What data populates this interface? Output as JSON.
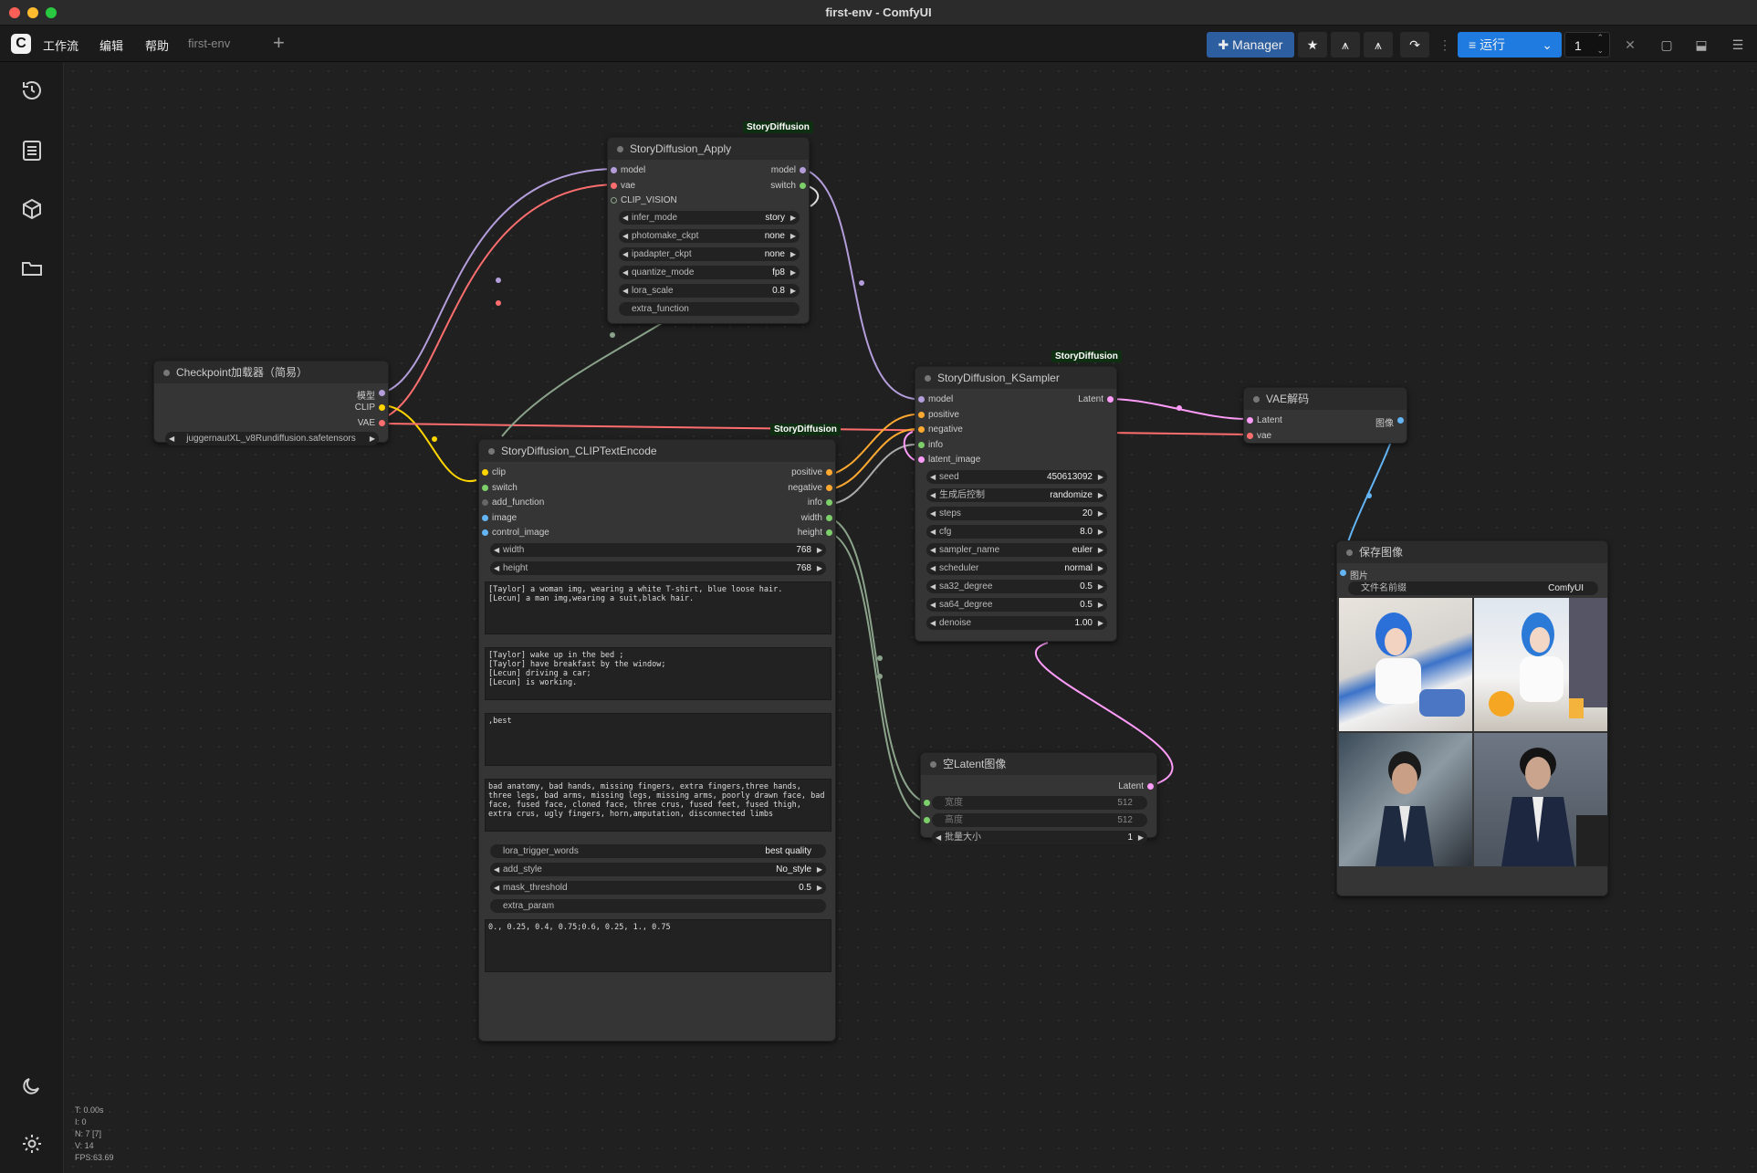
{
  "window": {
    "title": "first-env - ComfyUI"
  },
  "menu": {
    "items": [
      "工作流",
      "编辑",
      "帮助"
    ],
    "tab": "first-env"
  },
  "toolbar": {
    "manager": "Manager",
    "run": "运行",
    "count": "1"
  },
  "stats": {
    "t": "T: 0.00s",
    "i": "I: 0",
    "n": "N: 7 [7]",
    "v": "V: 14",
    "fps": "FPS:63.69"
  },
  "nodes": {
    "apply": {
      "badge": "StoryDiffusion",
      "title": "StoryDiffusion_Apply",
      "inputs": [
        "model",
        "vae",
        "CLIP_VISION"
      ],
      "outputs": [
        "model",
        "switch"
      ],
      "widgets": [
        {
          "label": "infer_mode",
          "value": "story"
        },
        {
          "label": "photomake_ckpt",
          "value": "none"
        },
        {
          "label": "ipadapter_ckpt",
          "value": "none"
        },
        {
          "label": "quantize_mode",
          "value": "fp8"
        },
        {
          "label": "lora_scale",
          "value": "0.8"
        },
        {
          "label": "extra_function",
          "value": ""
        }
      ]
    },
    "checkpoint": {
      "title": "Checkpoint加载器（简易）",
      "outputs": [
        "模型",
        "CLIP",
        "VAE"
      ],
      "ckpt": "juggernautXL_v8Rundiffusion.safetensors"
    },
    "clip": {
      "badge": "StoryDiffusion",
      "title": "StoryDiffusion_CLIPTextEncode",
      "inputs": [
        "clip",
        "switch",
        "add_function",
        "image",
        "control_image"
      ],
      "outputs": [
        "positive",
        "negative",
        "info",
        "width",
        "height"
      ],
      "widgets": [
        {
          "label": "width",
          "value": "768"
        },
        {
          "label": "height",
          "value": "768"
        }
      ],
      "texts": [
        "[Taylor] a woman img, wearing a white T-shirt, blue loose hair.\n[Lecun] a man img,wearing a suit,black hair.",
        "[Taylor] wake up in the bed ;\n[Taylor] have breakfast by the window;\n[Lecun] driving a car;\n[Lecun] is working.",
        ",best",
        "bad anatomy, bad hands, missing fingers, extra fingers,three hands, three legs, bad arms, missing legs, missing arms, poorly drawn face, bad face, fused face, cloned face, three crus, fused feet, fused thigh, extra crus, ugly fingers, horn,amputation, disconnected limbs"
      ],
      "widgets2": [
        {
          "label": "lora_trigger_words",
          "value": "best quality"
        },
        {
          "label": "add_style",
          "value": "No_style"
        },
        {
          "label": "mask_threshold",
          "value": "0.5"
        },
        {
          "label": "extra_param",
          "value": ""
        }
      ],
      "text_last": "0., 0.25, 0.4, 0.75;0.6, 0.25, 1., 0.75"
    },
    "ksampler": {
      "badge": "StoryDiffusion",
      "title": "StoryDiffusion_KSampler",
      "inputs": [
        "model",
        "positive",
        "negative",
        "info",
        "latent_image"
      ],
      "outputs": [
        "Latent"
      ],
      "widgets": [
        {
          "label": "seed",
          "value": "450613092"
        },
        {
          "label": "生成后控制",
          "value": "randomize"
        },
        {
          "label": "steps",
          "value": "20"
        },
        {
          "label": "cfg",
          "value": "8.0"
        },
        {
          "label": "sampler_name",
          "value": "euler"
        },
        {
          "label": "scheduler",
          "value": "normal"
        },
        {
          "label": "sa32_degree",
          "value": "0.5"
        },
        {
          "label": "sa64_degree",
          "value": "0.5"
        },
        {
          "label": "denoise",
          "value": "1.00"
        }
      ]
    },
    "vae": {
      "title": "VAE解码",
      "inputs": [
        "Latent",
        "vae"
      ],
      "outputs": [
        "图像"
      ]
    },
    "save": {
      "title": "保存图像",
      "inputs": [
        "图片"
      ],
      "prefix_label": "文件名前缀",
      "prefix_value": "ComfyUI"
    },
    "latent": {
      "title": "空Latent图像",
      "outputs": [
        "Latent"
      ],
      "widgets": [
        {
          "label": "宽度",
          "value": "512"
        },
        {
          "label": "高度",
          "value": "512"
        },
        {
          "label": "批量大小",
          "value": "1"
        }
      ]
    }
  },
  "colors": {
    "model": "#b39ddb",
    "clip": "#ffd500",
    "vae": "#ff6e6e",
    "latent": "#ff9cf9",
    "conditioning": "#ffa931",
    "image": "#64b5f6",
    "int": "#7ccf69",
    "accent": "#1f7be0"
  }
}
